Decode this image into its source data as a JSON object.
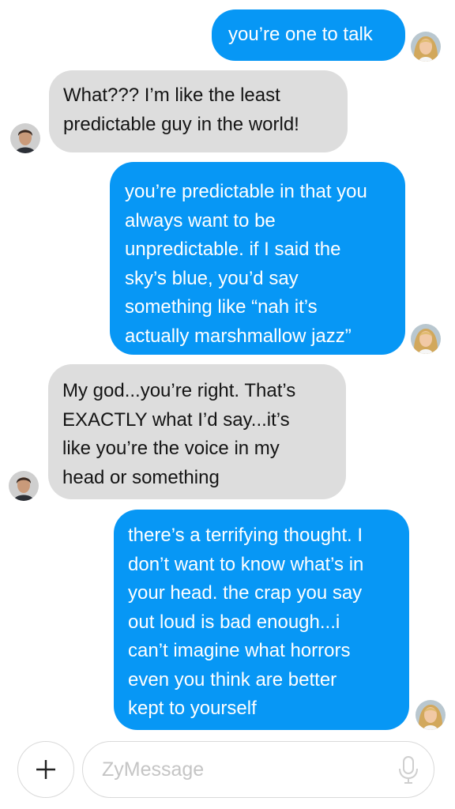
{
  "messages": [
    {
      "direction": "outgoing",
      "text": "you’re one to talk",
      "avatar": "woman-avatar-icon"
    },
    {
      "direction": "incoming",
      "text": "What??? I’m like the least\npredictable guy in the world!",
      "avatar": "man-avatar-icon"
    },
    {
      "direction": "outgoing",
      "text": "you’re predictable in that you\nalways want to be\nunpredictable. if I said the\nsky’s blue, you’d say\nsomething like “nah it’s\nactually marshmallow jazz”",
      "avatar": "woman-avatar-icon"
    },
    {
      "direction": "incoming",
      "text": "My god...you’re right. That’s\nEXACTLY what I’d say...it’s\nlike you’re the voice in my\nhead or something",
      "avatar": "man-avatar-icon"
    },
    {
      "direction": "outgoing",
      "text": "there’s a terrifying thought. I\ndon’t want to know what’s in\nyour head. the crap you say\nout loud is bad enough...i\ncan’t imagine what horrors\neven you think are better\nkept to yourself",
      "avatar": "woman-avatar-icon"
    }
  ],
  "composer": {
    "placeholder": "ZyMessage",
    "value": "",
    "add_icon": "plus-icon",
    "mic_icon": "microphone-icon"
  },
  "colors": {
    "outgoing_bubble": "#0797f5",
    "incoming_bubble": "#dddddd",
    "outgoing_text": "#ffffff",
    "incoming_text": "#141414"
  }
}
